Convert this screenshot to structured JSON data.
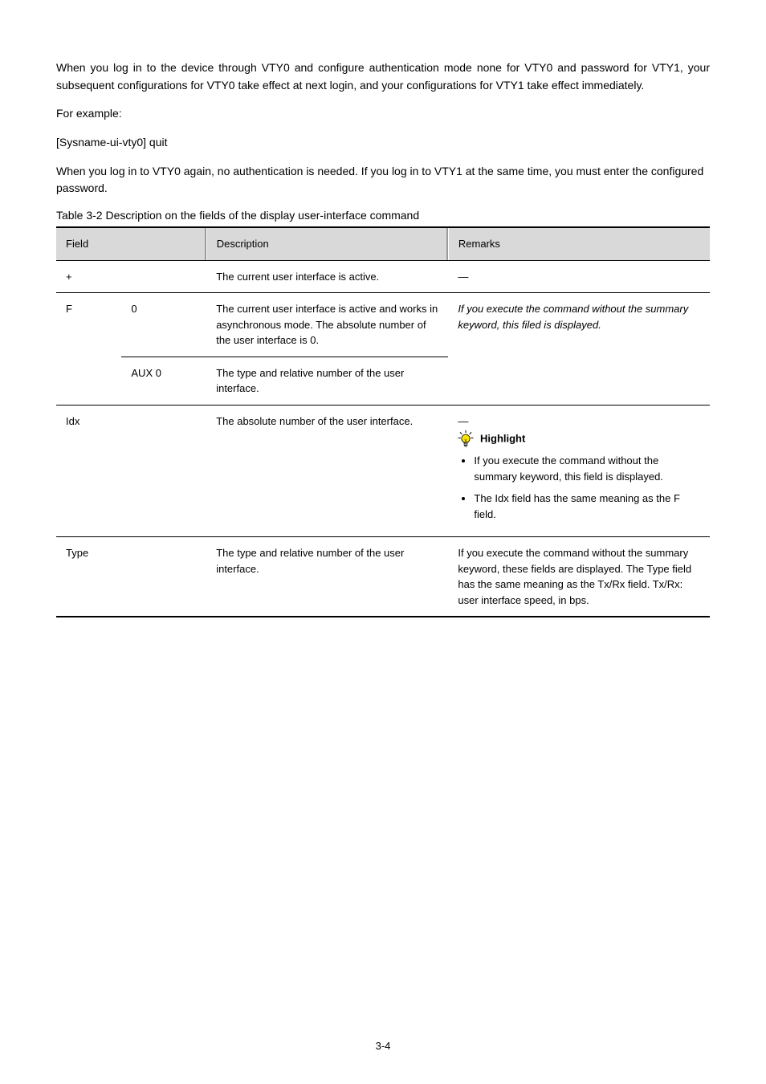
{
  "intro": "When you log in to the device through VTY0 and configure authentication mode none for VTY0 and password for VTY1, your subsequent configurations for VTY0 take effect at next login, and your configurations for VTY1 take effect immediately.",
  "example_label": "For example:",
  "example_line": "[Sysname-ui-vty0] quit",
  "intro2": "When you log in to VTY0 again, no authentication is needed. If you log in to VTY1 at the same time, you must enter the configured password.",
  "table_caption": "Table 3-2 Description on the fields of the display user-interface command",
  "table": {
    "headers": {
      "field": "Field",
      "description": "Description",
      "remarks": "Remarks"
    },
    "rows": [
      {
        "field_a": "+",
        "field_b": "",
        "rowspan_a": 1,
        "description": "The current user interface is active.",
        "remarks": "—"
      },
      {
        "field_a": "F",
        "field_b": "0",
        "rowspan_a": 2,
        "description": "The current user interface is active and works in asynchronous mode. The absolute number of the user interface is 0.",
        "remarks_rowspan": 2,
        "remarks": "If you execute the command without the summary keyword, this filed is displayed."
      },
      {
        "field_b": "AUX 0",
        "description": "The type and relative number of the user interface."
      },
      {
        "field_a": "Idx",
        "field_b": "",
        "description": "The absolute number of the user interface.",
        "remarks_is_highlight": true,
        "remarks_highlight_pre": "—",
        "highlight": {
          "label": "Highlight",
          "items": [
            "If you execute the command without the summary keyword, this field is displayed.",
            "The Idx field has the same meaning as the F field."
          ]
        }
      },
      {
        "field_a": "Type",
        "field_b": "",
        "description": "The type and relative number of the user interface.",
        "remarks": "If you execute the command without the summary keyword, these fields are displayed. The Type field has the same meaning as the Tx/Rx field. Tx/Rx: user interface speed, in bps."
      }
    ]
  },
  "page_number": "3-4"
}
